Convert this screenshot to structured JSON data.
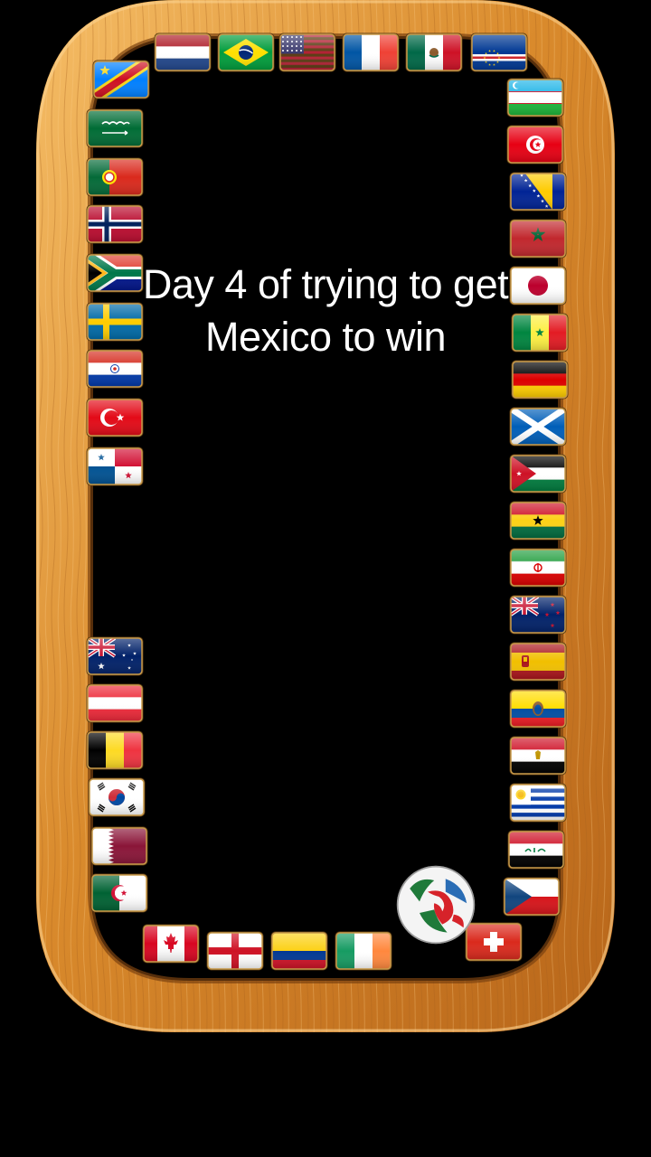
{
  "caption": {
    "line1": "Day 4 of trying to get",
    "line2": "Mexico to win"
  },
  "colors": {
    "background": "#000000",
    "frame_light": "#f2b25a",
    "frame_mid": "#d98a2c",
    "frame_dark": "#8a4d12",
    "flag_border": "#c89a4a"
  },
  "ball": {
    "icon": "soccer-ball-icon"
  },
  "flags": [
    {
      "name": "dr-congo"
    },
    {
      "name": "netherlands"
    },
    {
      "name": "brazil"
    },
    {
      "name": "usa"
    },
    {
      "name": "france"
    },
    {
      "name": "mexico"
    },
    {
      "name": "cape-verde"
    },
    {
      "name": "saudi-arabia"
    },
    {
      "name": "portugal"
    },
    {
      "name": "norway"
    },
    {
      "name": "south-africa"
    },
    {
      "name": "sweden"
    },
    {
      "name": "paraguay"
    },
    {
      "name": "turkey"
    },
    {
      "name": "panama"
    },
    {
      "name": "australia"
    },
    {
      "name": "austria"
    },
    {
      "name": "belgium"
    },
    {
      "name": "south-korea"
    },
    {
      "name": "qatar"
    },
    {
      "name": "algeria"
    },
    {
      "name": "uzbekistan"
    },
    {
      "name": "tunisia"
    },
    {
      "name": "bosnia"
    },
    {
      "name": "morocco"
    },
    {
      "name": "japan"
    },
    {
      "name": "senegal"
    },
    {
      "name": "germany"
    },
    {
      "name": "scotland"
    },
    {
      "name": "jordan"
    },
    {
      "name": "ghana"
    },
    {
      "name": "iran"
    },
    {
      "name": "new-zealand"
    },
    {
      "name": "spain"
    },
    {
      "name": "ecuador"
    },
    {
      "name": "egypt"
    },
    {
      "name": "uruguay"
    },
    {
      "name": "iraq"
    },
    {
      "name": "czechia"
    },
    {
      "name": "switzerland"
    },
    {
      "name": "canada"
    },
    {
      "name": "england"
    },
    {
      "name": "colombia"
    },
    {
      "name": "ireland"
    }
  ]
}
